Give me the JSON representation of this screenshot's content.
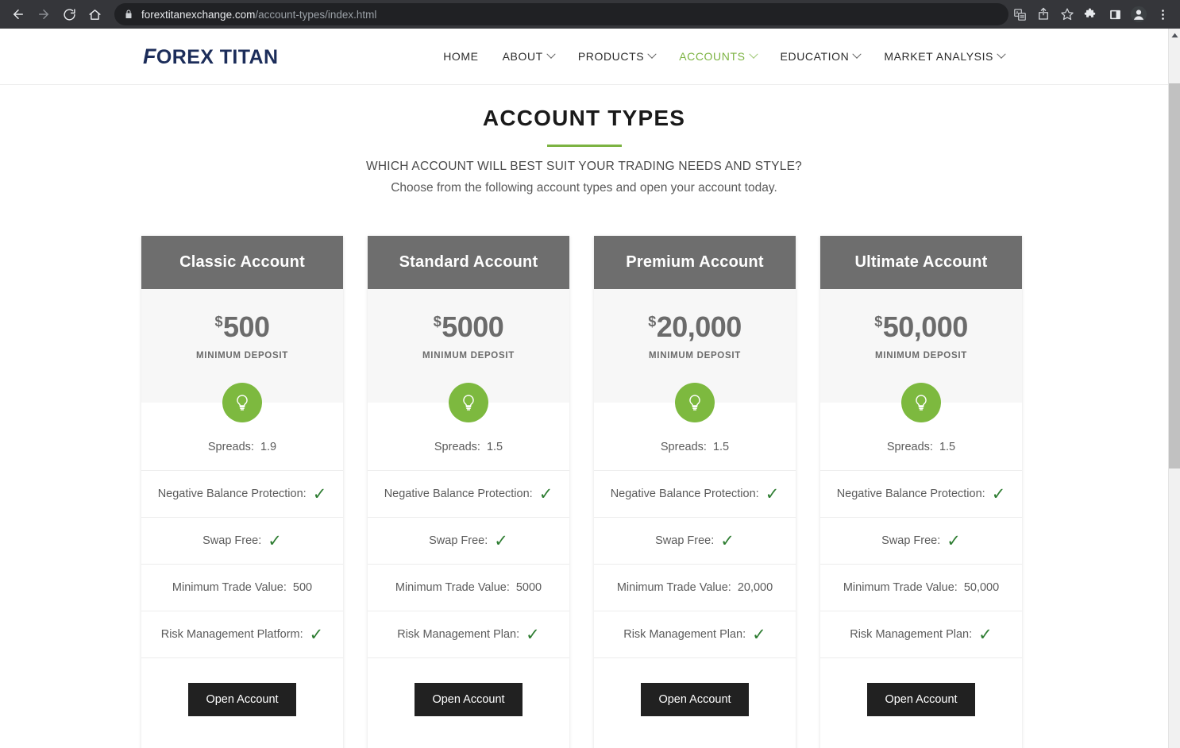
{
  "browser": {
    "url_domain": "forextitanexchange.com",
    "url_path": "/account-types/index.html",
    "back_icon": "back-arrow-icon",
    "forward_icon": "forward-arrow-icon",
    "reload_icon": "reload-icon",
    "home_icon": "home-icon",
    "lock_icon": "lock-icon",
    "translate_icon": "translate-icon",
    "share_icon": "share-icon",
    "bookmark_icon": "bookmark-star-icon",
    "extensions_icon": "puzzle-icon",
    "sidepanel_icon": "side-panel-icon",
    "profile_icon": "profile-avatar-icon",
    "menu_icon": "three-dot-menu-icon"
  },
  "site": {
    "logo_first": "F",
    "logo_rest": "OREX TITAN",
    "nav": [
      {
        "label": "HOME",
        "has_chevron": false,
        "active": false
      },
      {
        "label": "ABOUT",
        "has_chevron": true,
        "active": false
      },
      {
        "label": "PRODUCTS",
        "has_chevron": true,
        "active": false
      },
      {
        "label": "ACCOUNTS",
        "has_chevron": true,
        "active": true
      },
      {
        "label": "EDUCATION",
        "has_chevron": true,
        "active": false
      },
      {
        "label": "MARKET ANALYSIS",
        "has_chevron": true,
        "active": false
      }
    ]
  },
  "hero": {
    "title": "ACCOUNT TYPES",
    "subheading": "WHICH ACCOUNT WILL BEST SUIT YOUR TRADING NEEDS AND STYLE?",
    "subtext": "Choose from the following account types and open your account today."
  },
  "colors": {
    "accent_green": "#7cb342",
    "bulb_green": "#7db93f",
    "card_header_gray": "#6e6e6e",
    "price_gray": "#6b6b6b",
    "button_dark": "#212121",
    "logo_navy": "#1c2d5a",
    "tick_green": "#2e7d32"
  },
  "price_label": "MINIMUM DEPOSIT",
  "currency_symbol": "$",
  "cta_label": "Open Account",
  "bulb_icon": "lightbulb-icon",
  "cards": [
    {
      "title": "Classic Account",
      "price": "500",
      "features": [
        {
          "label": "Spreads:",
          "value": "1.9",
          "tick": false
        },
        {
          "label": "Negative Balance Protection:",
          "value": "",
          "tick": true
        },
        {
          "label": "Swap Free:",
          "value": "",
          "tick": true
        },
        {
          "label": "Minimum Trade Value:",
          "value": "500",
          "tick": false
        },
        {
          "label": "Risk Management Platform:",
          "value": "",
          "tick": true
        }
      ]
    },
    {
      "title": "Standard Account",
      "price": "5000",
      "features": [
        {
          "label": "Spreads:",
          "value": "1.5",
          "tick": false
        },
        {
          "label": "Negative Balance Protection:",
          "value": "",
          "tick": true
        },
        {
          "label": "Swap Free:",
          "value": "",
          "tick": true
        },
        {
          "label": "Minimum Trade Value:",
          "value": "5000",
          "tick": false
        },
        {
          "label": "Risk Management Plan:",
          "value": "",
          "tick": true
        }
      ]
    },
    {
      "title": "Premium Account",
      "price": "20,000",
      "features": [
        {
          "label": "Spreads:",
          "value": "1.5",
          "tick": false
        },
        {
          "label": "Negative Balance Protection:",
          "value": "",
          "tick": true
        },
        {
          "label": "Swap Free:",
          "value": "",
          "tick": true
        },
        {
          "label": "Minimum Trade Value:",
          "value": "20,000",
          "tick": false
        },
        {
          "label": "Risk Management Plan:",
          "value": "",
          "tick": true
        }
      ]
    },
    {
      "title": "Ultimate Account",
      "price": "50,000",
      "features": [
        {
          "label": "Spreads:",
          "value": "1.5",
          "tick": false
        },
        {
          "label": "Negative Balance Protection:",
          "value": "",
          "tick": true
        },
        {
          "label": "Swap Free:",
          "value": "",
          "tick": true
        },
        {
          "label": "Minimum Trade Value:",
          "value": "50,000",
          "tick": false
        },
        {
          "label": "Risk Management Plan:",
          "value": "",
          "tick": true
        }
      ]
    }
  ]
}
